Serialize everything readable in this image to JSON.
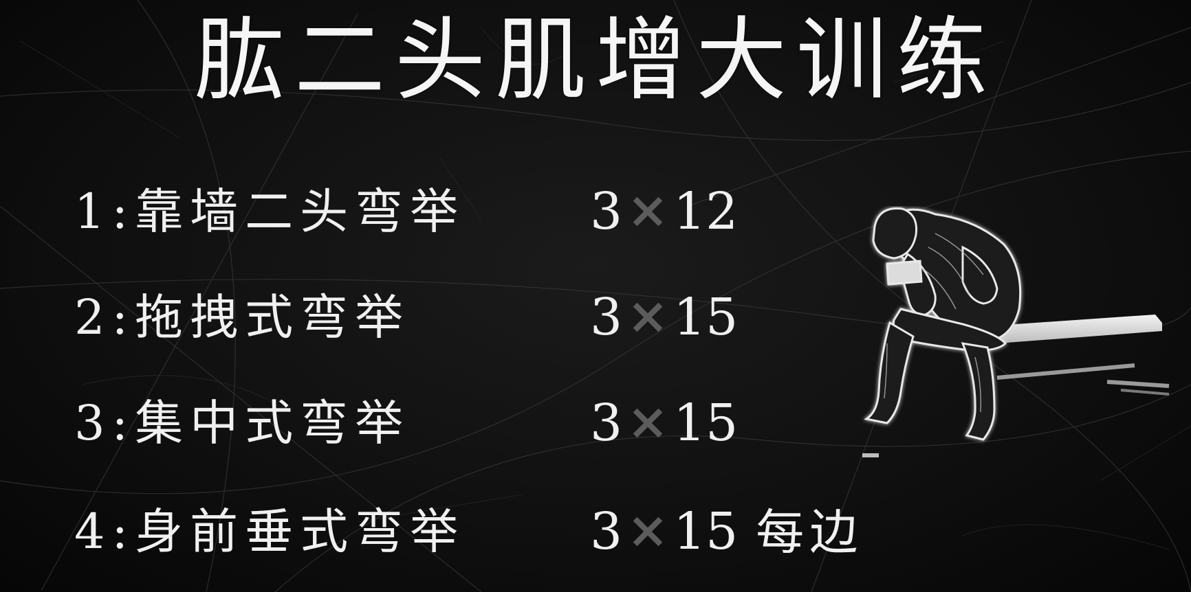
{
  "title": "肱二头肌增大训练",
  "exercises": [
    {
      "label": "1:靠墙二头弯举",
      "sets": "3",
      "reps": "12",
      "suffix": ""
    },
    {
      "label": "2:拖拽式弯举",
      "sets": "3",
      "reps": "15",
      "suffix": ""
    },
    {
      "label": "3:集中式弯举",
      "sets": "3",
      "reps": "15",
      "suffix": ""
    },
    {
      "label": "4:身前垂式弯举",
      "sets": "3",
      "reps": "15",
      "suffix": "每边"
    }
  ],
  "icons": {
    "multiply": "times-icon",
    "figure": "concentration-curl-figure-icon"
  },
  "colors": {
    "background": "#0b0b0b",
    "text": "#f2f2f2",
    "multiply": "#5c5c5c"
  }
}
